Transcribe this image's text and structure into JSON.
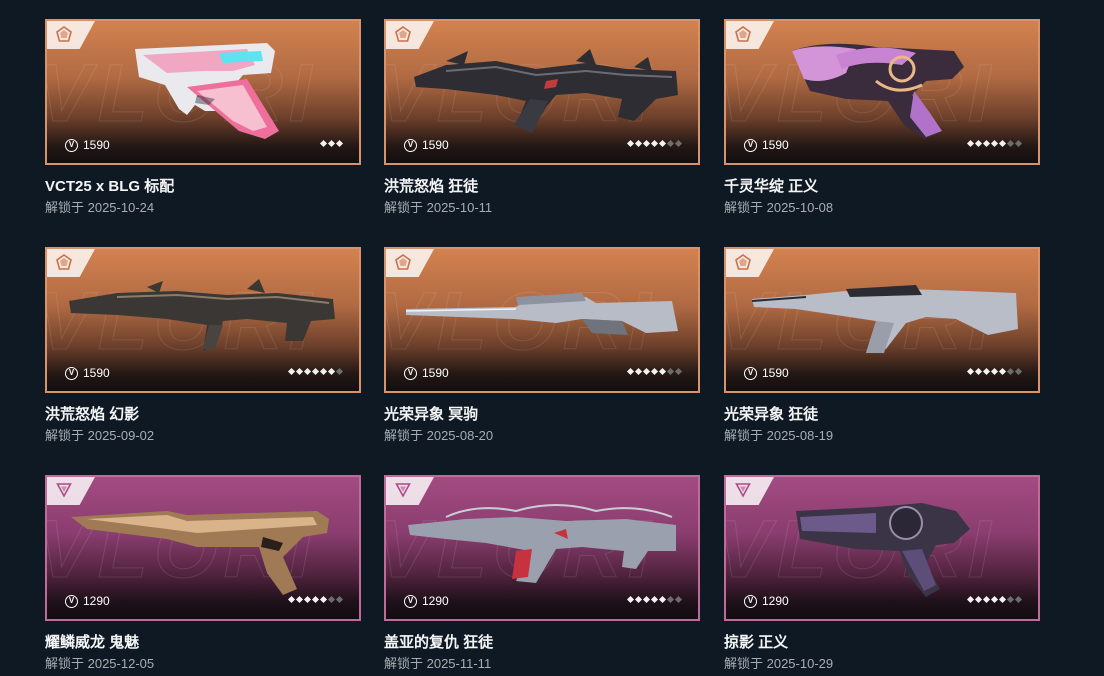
{
  "unlock_prefix": "解锁于",
  "skins": [
    {
      "name": "VCT25 x BLG 标配",
      "date": "解锁于 2025-10-24",
      "price": "1590",
      "tier": "orange",
      "levels_total": 3,
      "levels_active": 3
    },
    {
      "name": "洪荒怒焰 狂徒",
      "date": "解锁于 2025-10-11",
      "price": "1590",
      "tier": "orange",
      "levels_total": 7,
      "levels_active": 5
    },
    {
      "name": "千灵华绽 正义",
      "date": "解锁于 2025-10-08",
      "price": "1590",
      "tier": "orange",
      "levels_total": 7,
      "levels_active": 5
    },
    {
      "name": "洪荒怒焰 幻影",
      "date": "解锁于 2025-09-02",
      "price": "1590",
      "tier": "orange",
      "levels_total": 7,
      "levels_active": 6
    },
    {
      "name": "光荣异象 冥驹",
      "date": "解锁于 2025-08-20",
      "price": "1590",
      "tier": "orange",
      "levels_total": 7,
      "levels_active": 5
    },
    {
      "name": "光荣异象 狂徒",
      "date": "解锁于 2025-08-19",
      "price": "1590",
      "tier": "orange",
      "levels_total": 7,
      "levels_active": 5
    },
    {
      "name": "耀鳞威龙 鬼魅",
      "date": "解锁于 2025-12-05",
      "price": "1290",
      "tier": "pink",
      "levels_total": 7,
      "levels_active": 5
    },
    {
      "name": "盖亚的复仇 狂徒",
      "date": "解锁于 2025-11-11",
      "price": "1290",
      "tier": "pink",
      "levels_total": 7,
      "levels_active": 5
    },
    {
      "name": "掠影 正义",
      "date": "解锁于 2025-10-29",
      "price": "1290",
      "tier": "pink",
      "levels_total": 7,
      "levels_active": 5
    }
  ],
  "colors": {
    "background": "#0f1923",
    "orange_tier_border": "#d8936a",
    "pink_tier_border": "#c06a99"
  },
  "icons": {
    "tier_orange": "pentagon-tier-icon",
    "tier_pink": "triangle-tier-icon",
    "currency": "vp-currency-icon",
    "level": "diamond-level-icon"
  }
}
